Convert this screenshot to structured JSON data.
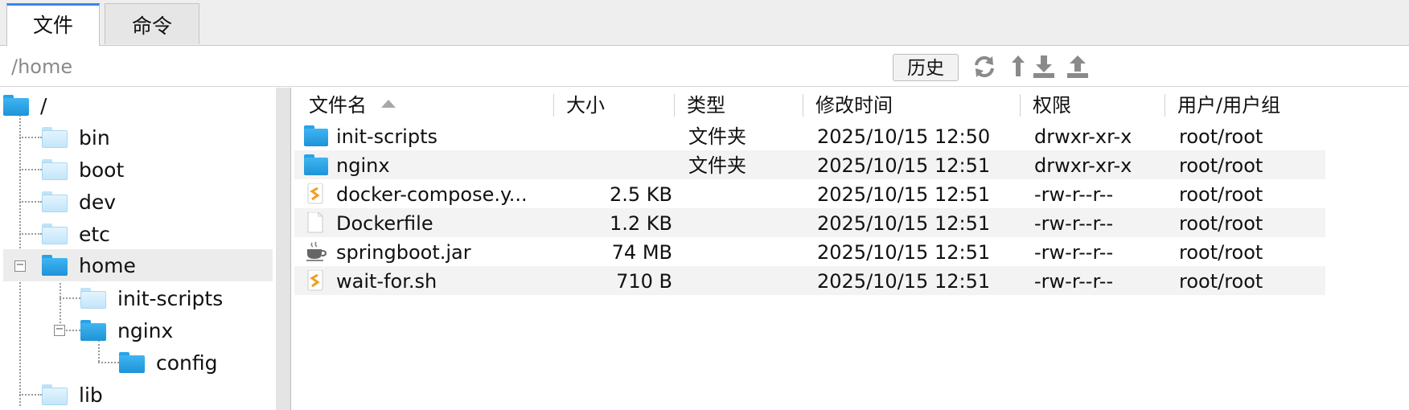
{
  "tabs": [
    {
      "label": "文件",
      "active": true
    },
    {
      "label": "命令",
      "active": false
    }
  ],
  "pathbar": {
    "path": "/home",
    "history_label": "历史",
    "icons": [
      "refresh-icon",
      "up-arrow-icon",
      "download-icon",
      "upload-icon"
    ]
  },
  "tree": {
    "nodes": [
      {
        "label": "/"
      },
      {
        "label": "bin"
      },
      {
        "label": "boot"
      },
      {
        "label": "dev"
      },
      {
        "label": "etc"
      },
      {
        "label": "home",
        "expanded": true,
        "selected": true
      },
      {
        "label": "init-scripts"
      },
      {
        "label": "nginx",
        "expanded": true
      },
      {
        "label": "config"
      },
      {
        "label": "lib"
      }
    ]
  },
  "table": {
    "columns": [
      "文件名",
      "大小",
      "类型",
      "修改时间",
      "权限",
      "用户/用户组"
    ],
    "sorted_by": "文件名",
    "rows": [
      {
        "icon": "folder-icon",
        "name": "init-scripts",
        "size": "",
        "type": "文件夹",
        "mtime": "2025/10/15 12:50",
        "perm": "drwxr-xr-x",
        "owner": "root/root"
      },
      {
        "icon": "folder-icon",
        "name": "nginx",
        "size": "",
        "type": "文件夹",
        "mtime": "2025/10/15 12:51",
        "perm": "drwxr-xr-x",
        "owner": "root/root"
      },
      {
        "icon": "script-file-icon",
        "name": "docker-compose.y...",
        "size": "2.5 KB",
        "type": "",
        "mtime": "2025/10/15 12:51",
        "perm": "-rw-r--r--",
        "owner": "root/root"
      },
      {
        "icon": "blank-file-icon",
        "name": "Dockerfile",
        "size": "1.2 KB",
        "type": "",
        "mtime": "2025/10/15 12:51",
        "perm": "-rw-r--r--",
        "owner": "root/root"
      },
      {
        "icon": "java-jar-icon",
        "name": "springboot.jar",
        "size": "74 MB",
        "type": "",
        "mtime": "2025/10/15 12:51",
        "perm": "-rw-r--r--",
        "owner": "root/root"
      },
      {
        "icon": "script-file-icon",
        "name": "wait-for.sh",
        "size": "710 B",
        "type": "",
        "mtime": "2025/10/15 12:51",
        "perm": "-rw-r--r--",
        "owner": "root/root"
      }
    ]
  },
  "colors": {
    "accent": "#3b82f6",
    "folder": "#29a3e6",
    "script": "#f0a020"
  }
}
